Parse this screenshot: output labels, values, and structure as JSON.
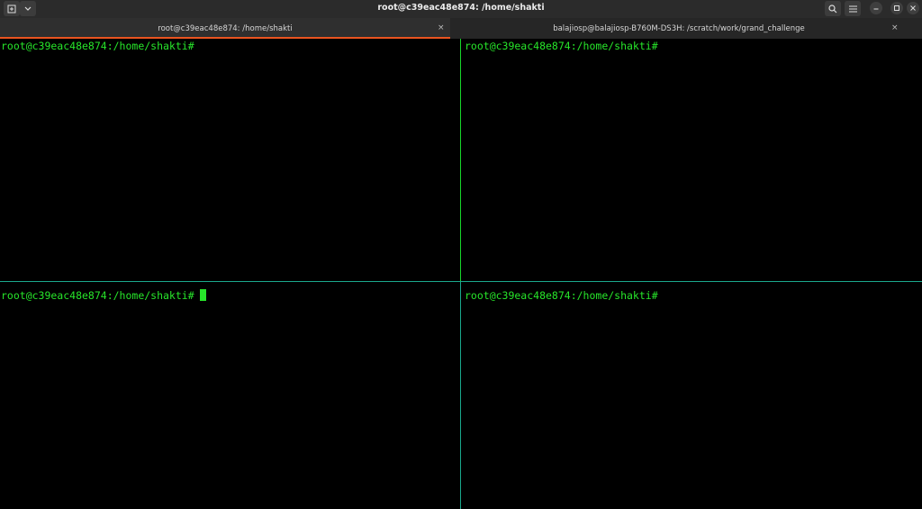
{
  "window": {
    "title": "root@c39eac48e874: /home/shakti",
    "icons": {
      "new_tab": "new-tab-icon",
      "menu_dropdown": "chevron-down-icon",
      "search": "search-icon",
      "hamburger": "hamburger-menu-icon",
      "minimize": "minimize-icon",
      "maximize": "maximize-icon",
      "close": "close-icon"
    }
  },
  "tabs": [
    {
      "label": "root@c39eac48e874: /home/shakti",
      "active": true,
      "close": "×"
    },
    {
      "label": "balajiosp@balajiosp-B760M-DS3H: /scratch/work/grand_challenge",
      "active": false,
      "close": "×"
    }
  ],
  "panes": {
    "top_left": {
      "prompt": "root@c39eac48e874:/home/shakti#"
    },
    "top_right": {
      "prompt": "root@c39eac48e874:/home/shakti#"
    },
    "bottom_left": {
      "prompt": "root@c39eac48e874:/home/shakti#",
      "has_cursor": true
    },
    "bottom_right": {
      "prompt": "root@c39eac48e874:/home/shakti#"
    }
  },
  "colors": {
    "prompt_green": "#27e52a",
    "active_tab_accent": "#e95420",
    "vertical_divider": "#17d72a",
    "horizontal_divider": "#1aa88c"
  }
}
